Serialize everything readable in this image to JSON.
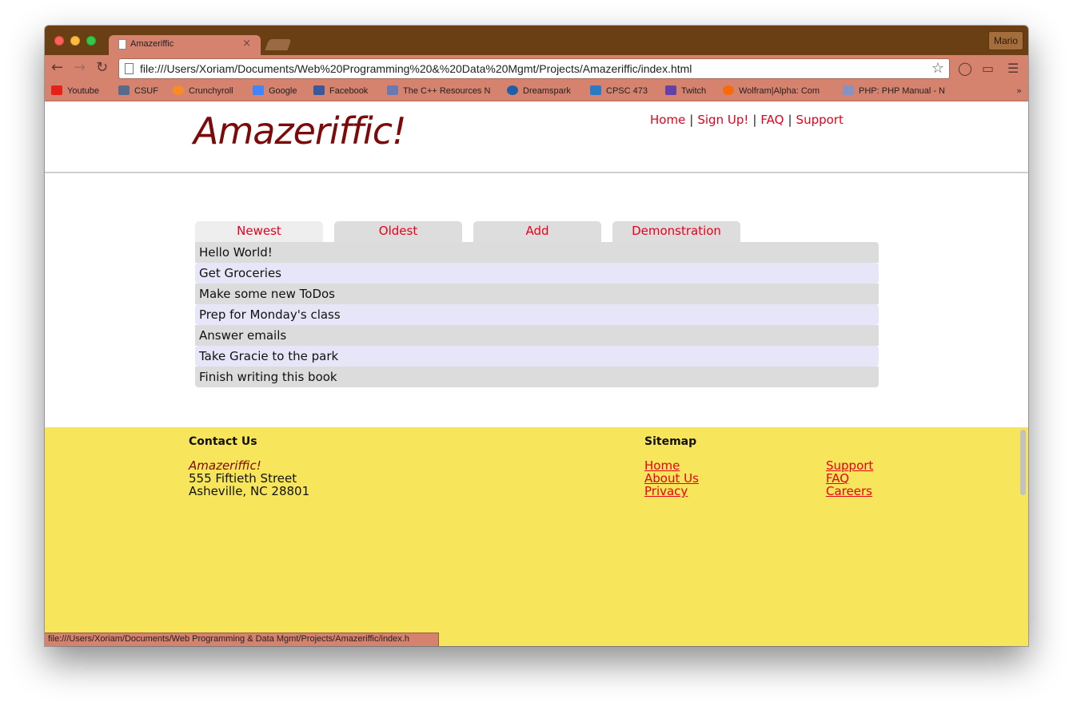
{
  "browser": {
    "tab_title": "Amazeriffic",
    "tab_close": "×",
    "profile_name": "Mario",
    "url": "file:///Users/Xoriam/Documents/Web%20Programming%20&%20Data%20Mgmt/Projects/Amazeriffic/index.html",
    "status_url": "file:///Users/Xoriam/Documents/Web Programming & Data Mgmt/Projects/Amazeriffic/index.h",
    "bookmarks_more": "»",
    "bookmarks": [
      {
        "label": "Youtube",
        "icon": "youtube-icon",
        "color": "#e62117"
      },
      {
        "label": "CSUF",
        "icon": "csuf-icon",
        "color": "#5a6a8a"
      },
      {
        "label": "Crunchyroll",
        "icon": "crunchyroll-icon",
        "color": "#f78c25"
      },
      {
        "label": "Google",
        "icon": "google-icon",
        "color": "#4285f4"
      },
      {
        "label": "Facebook",
        "icon": "facebook-icon",
        "color": "#3b5998"
      },
      {
        "label": "The C++ Resources N",
        "icon": "cpp-icon",
        "color": "#6a7ab0"
      },
      {
        "label": "Dreamspark",
        "icon": "dreamspark-icon",
        "color": "#1e5fa8"
      },
      {
        "label": "CPSC 473",
        "icon": "cpsc-icon",
        "color": "#2b7bc4"
      },
      {
        "label": "Twitch",
        "icon": "twitch-icon",
        "color": "#6441a5"
      },
      {
        "label": "Wolfram|Alpha: Com",
        "icon": "wolfram-icon",
        "color": "#f96a0a"
      },
      {
        "label": "PHP: PHP Manual - N",
        "icon": "php-icon",
        "color": "#8892bf"
      }
    ]
  },
  "site": {
    "logo": "Amazeriffic!",
    "nav": [
      "Home",
      "Sign Up!",
      "FAQ",
      "Support"
    ],
    "nav_separator": "|"
  },
  "tabs": [
    {
      "label": "Newest",
      "active": true
    },
    {
      "label": "Oldest",
      "active": false
    },
    {
      "label": "Add",
      "active": false
    },
    {
      "label": "Demonstration",
      "active": false
    }
  ],
  "todos": [
    "Hello World!",
    "Get Groceries",
    "Make some new ToDos",
    "Prep for Monday's class",
    "Answer emails",
    "Take Gracie to the park",
    "Finish writing this book"
  ],
  "footer": {
    "contact_heading": "Contact Us",
    "company": "Amazeriffic!",
    "address_line1": "555 Fiftieth Street",
    "address_line2": "Asheville, NC 28801",
    "sitemap_heading": "Sitemap",
    "sitemap_col1": [
      "Home",
      "About Us",
      "Privacy"
    ],
    "sitemap_col2": [
      "Support",
      "FAQ",
      "Careers"
    ]
  },
  "colors": {
    "link": "#e8001c",
    "logo": "#7d0a0a",
    "footer_bg": "#f7e65b",
    "chrome_frame": "#6b3f14",
    "chrome_toolbar": "#d5826f"
  }
}
